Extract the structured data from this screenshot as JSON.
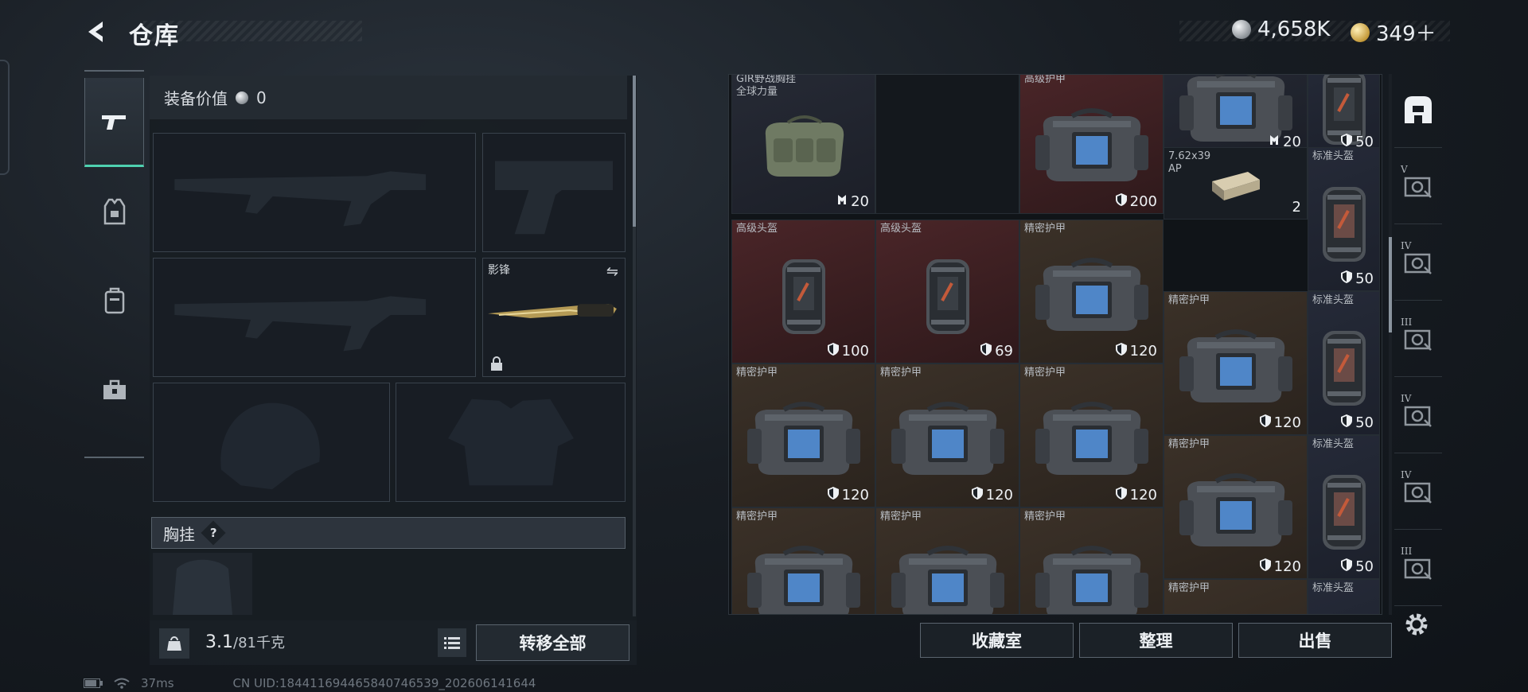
{
  "header": {
    "title": "仓库",
    "currency": {
      "silver": "4,658K",
      "gold": "349＋"
    }
  },
  "tabs": [
    {
      "name": "weapons"
    },
    {
      "name": "armor"
    },
    {
      "name": "backpack"
    },
    {
      "name": "tools"
    }
  ],
  "equipment": {
    "value_label": "装备价值",
    "value": "0",
    "melee_slot_label": "影锋",
    "rig_label": "胸挂",
    "help_mark": "?",
    "weight_current": "3.1",
    "weight_max": "/81千克",
    "transfer_all": "转移全部"
  },
  "stash": {
    "items": [
      {
        "name": "GIR野战胸挂\n全球力量",
        "value": "20",
        "icon": "capacity-icon",
        "bg": "purple"
      },
      {
        "name": "",
        "value": "",
        "icon": "",
        "bg": "empty"
      },
      {
        "name": "高级护甲",
        "value": "200",
        "icon": "shield-icon",
        "bg": "red"
      },
      {
        "name": "",
        "value": "20",
        "icon": "capacity-icon",
        "bg": "purple"
      },
      {
        "name": "",
        "value": "50",
        "icon": "shield-icon",
        "bg": "navy"
      },
      {
        "name": "7.62x39\nAP",
        "value": "2",
        "icon": "",
        "bg": "dark"
      },
      {
        "name": "标准头盔",
        "value": "50",
        "icon": "shield-icon",
        "bg": "navy"
      },
      {
        "name": "高级头盔",
        "value": "100",
        "icon": "shield-icon",
        "bg": "red"
      },
      {
        "name": "高级头盔",
        "value": "69",
        "icon": "shield-icon",
        "bg": "red"
      },
      {
        "name": "精密护甲",
        "value": "120",
        "icon": "shield-icon",
        "bg": "brown"
      },
      {
        "name": "精密护甲",
        "value": "120",
        "icon": "shield-icon",
        "bg": "brown"
      },
      {
        "name": "标准头盔",
        "value": "50",
        "icon": "shield-icon",
        "bg": "navy"
      },
      {
        "name": "精密护甲",
        "value": "120",
        "icon": "shield-icon",
        "bg": "brown"
      },
      {
        "name": "精密护甲",
        "value": "120",
        "icon": "shield-icon",
        "bg": "brown"
      },
      {
        "name": "精密护甲",
        "value": "120",
        "icon": "shield-icon",
        "bg": "brown"
      },
      {
        "name": "精密护甲",
        "value": "120",
        "icon": "shield-icon",
        "bg": "brown"
      },
      {
        "name": "标准头盔",
        "value": "50",
        "icon": "shield-icon",
        "bg": "navy"
      },
      {
        "name": "精密护甲",
        "value": "",
        "icon": "",
        "bg": "brown"
      },
      {
        "name": "精密护甲",
        "value": "",
        "icon": "",
        "bg": "brown"
      },
      {
        "name": "精密护甲",
        "value": "",
        "icon": "",
        "bg": "brown"
      },
      {
        "name": "精密护甲",
        "value": "",
        "icon": "",
        "bg": "brown"
      },
      {
        "name": "标准头盔",
        "value": "",
        "icon": "",
        "bg": "navy"
      }
    ]
  },
  "actions": {
    "collection": "收藏室",
    "organize": "整理",
    "sell": "出售"
  },
  "filters": [
    {
      "tier": "",
      "name": "all"
    },
    {
      "tier": "V",
      "name": "armor"
    },
    {
      "tier": "IV",
      "name": "armor"
    },
    {
      "tier": "III",
      "name": "armor"
    },
    {
      "tier": "IV",
      "name": "medical"
    },
    {
      "tier": "IV",
      "name": "folder"
    },
    {
      "tier": "III",
      "name": "weapon"
    }
  ],
  "status_bar": {
    "ping": "37ms",
    "uid": "CN UID:184411694465840746539_202606141644"
  },
  "colors": {
    "accent": "#4fd1b0",
    "panel": "#181d23",
    "red_rarity": "#4a2528",
    "brown_rarity": "#3b3128"
  }
}
